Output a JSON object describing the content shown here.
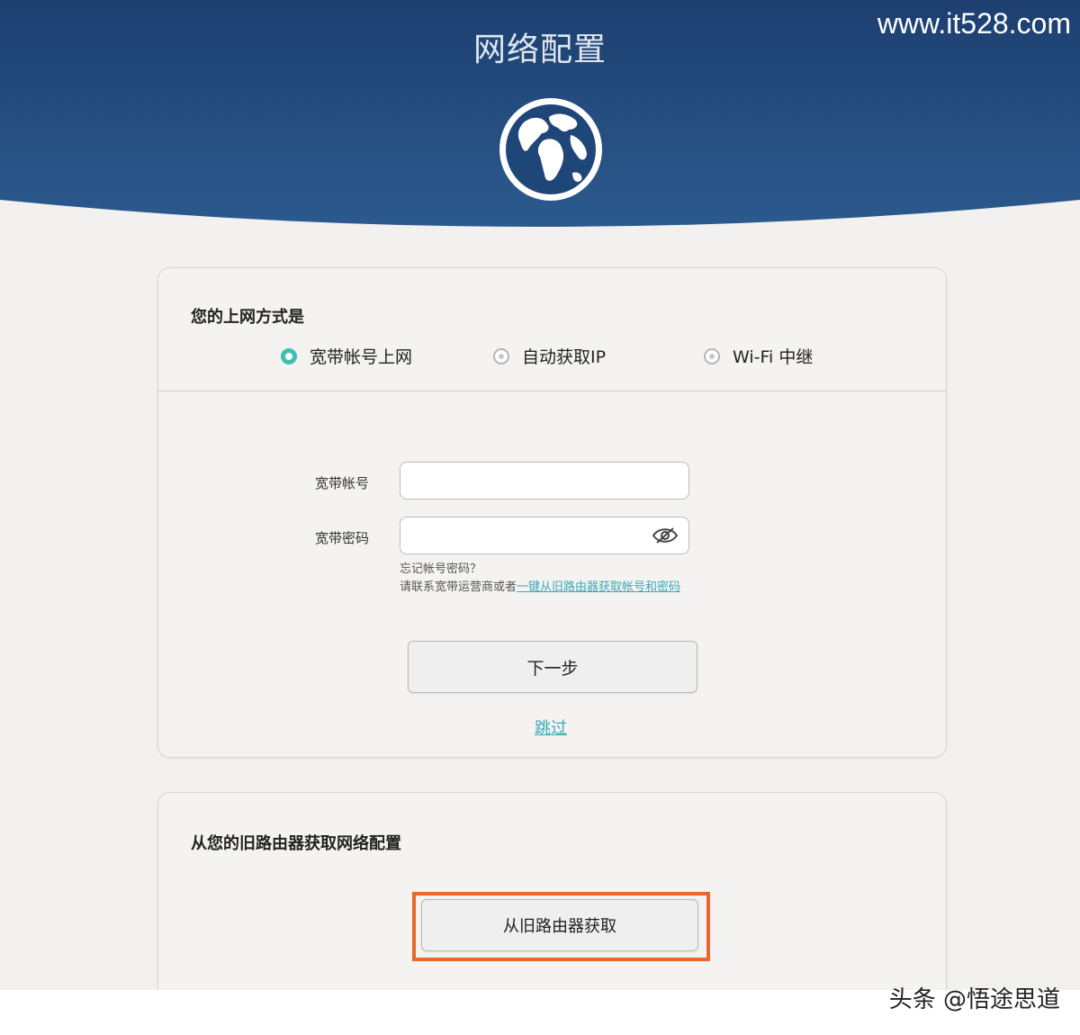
{
  "header": {
    "title": "网络配置",
    "watermark": "www.it528.com",
    "background_color": "#1f4679",
    "globe_icon": "globe-icon"
  },
  "connection": {
    "heading": "您的上网方式是",
    "options": [
      {
        "label": "宽带帐号上网",
        "selected": true
      },
      {
        "label": "自动获取IP",
        "selected": false
      },
      {
        "label": "Wi-Fi 中继",
        "selected": false
      }
    ],
    "accent_color": "#3dbfb2"
  },
  "form": {
    "account_label": "宽带帐号",
    "account_value": "",
    "password_label": "宽带密码",
    "password_value": "",
    "password_toggle_icon": "eye-hidden-icon",
    "hint_line1": "忘记帐号密码？",
    "hint_line2_prefix": "请联系宽带运营商或者",
    "hint_link": "一键从旧路由器获取帐号和密码",
    "next_button": "下一步",
    "skip_link": "跳过"
  },
  "legacy": {
    "heading": "从您的旧路由器获取网络配置",
    "button": "从旧路由器获取",
    "highlight_color": "#e8682f"
  },
  "footer": {
    "watermark": "头条 @悟途思道"
  }
}
